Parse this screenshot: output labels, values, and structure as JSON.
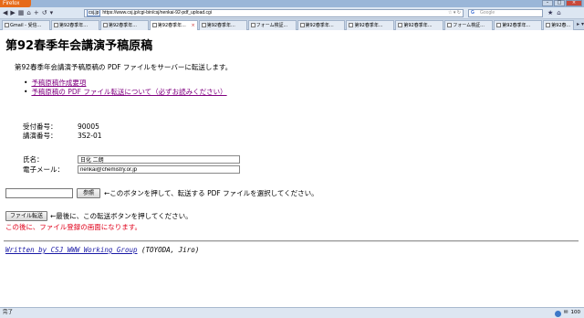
{
  "browser": {
    "menu_label": "Firefox",
    "url_domain": "csj.jp",
    "url": "https://www.csj.jp/cgi-bin/csj/nenkai-92-pdf_upload.cgi",
    "search_placeholder": "Google",
    "search_engine_glyph": "G",
    "tabs": [
      {
        "label": "Gmail - 受信..."
      },
      {
        "label": "第92春季年..."
      },
      {
        "label": "第92春季年..."
      },
      {
        "label": "第92春季年...",
        "active": true
      },
      {
        "label": "第92春季年..."
      },
      {
        "label": "フォーム検証..."
      },
      {
        "label": "第92春季年..."
      },
      {
        "label": "第92春季年..."
      },
      {
        "label": "第92春季年..."
      },
      {
        "label": "フォーム検証..."
      },
      {
        "label": "第92春季年..."
      },
      {
        "label": "第92春..."
      }
    ],
    "status_text": "完了",
    "status_zoom": "100"
  },
  "page": {
    "title": "第92春季年会講演予稿原稿",
    "intro": "第92春季年会講演予稿原稿の PDF ファイルをサーバーに転送します。",
    "links": [
      "予稿原稿作成要項",
      "予稿原稿の PDF ファイル転送について（必ずお読みください）"
    ],
    "info": {
      "reception_label": "受付番号：",
      "reception_value": "90005",
      "lecture_label": "講演番号：",
      "lecture_value": "3S2-01"
    },
    "form": {
      "name_label": "氏名：",
      "name_value": "日化 二朗",
      "email_label": "電子メール：",
      "email_value": "nenkai@chemistry.or.jp"
    },
    "browse_button": "参照",
    "browse_hint": "←このボタンを押して、転送する PDF ファイルを選択してください。",
    "send_button": "ファイル転送",
    "send_hint": "←最後に、この転送ボタンを押してください。",
    "warning": "この後に、ファイル登録の画面になります。",
    "footer_link": "Written by CSJ WWW Working Group",
    "footer_note": "(TOYODA, Jiro)"
  }
}
